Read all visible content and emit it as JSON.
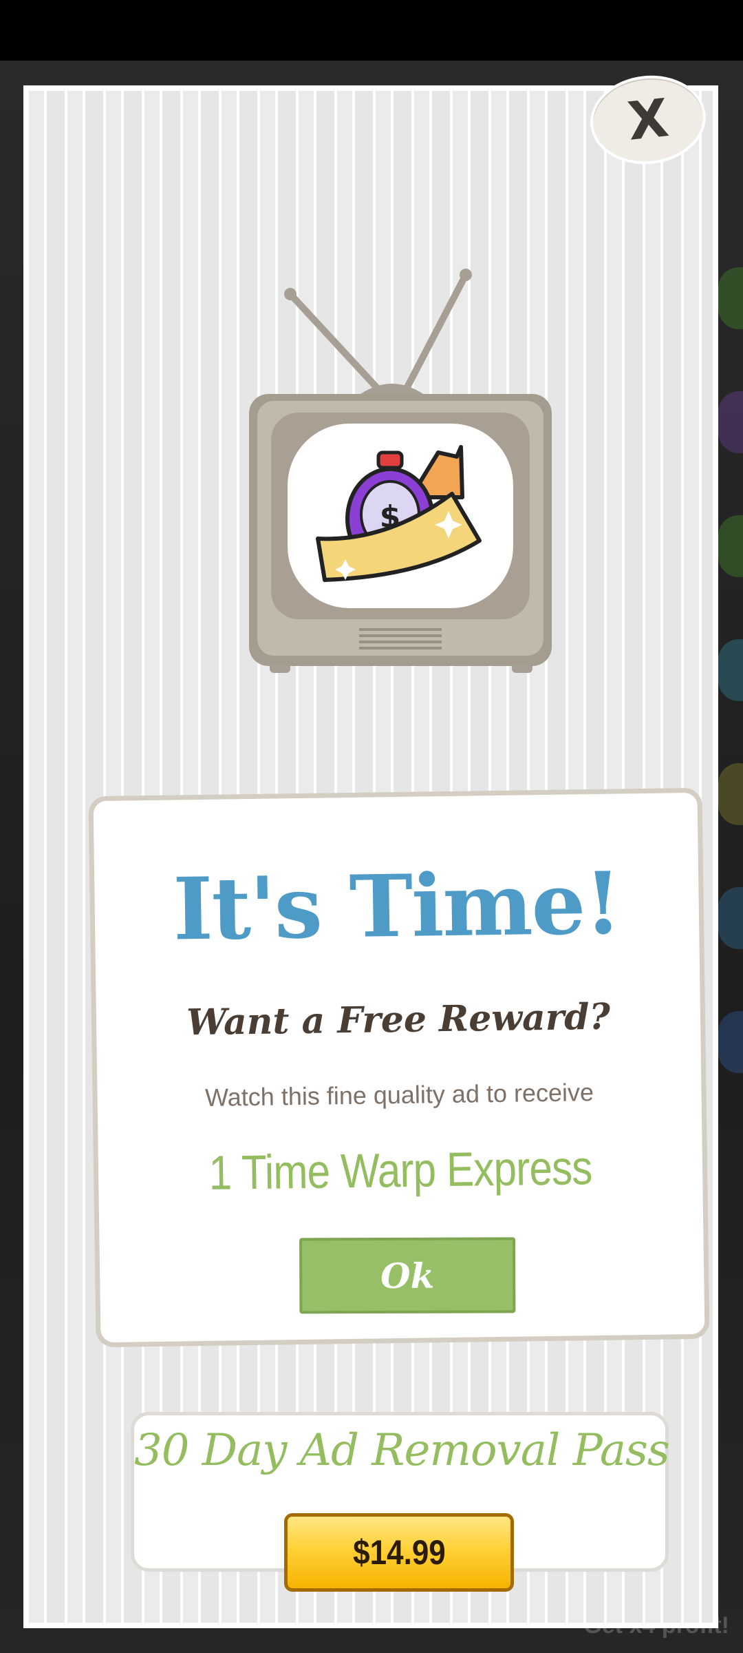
{
  "modal": {
    "close_label": "X",
    "title": "It's Time!",
    "subtitle": "Want a Free Reward?",
    "description": "Watch this fine quality ad to receive",
    "reward": "1 Time Warp Express",
    "ok_label": "Ok"
  },
  "pass": {
    "title": "30 Day Ad Removal Pass",
    "price": "$14.99"
  },
  "background": {
    "bottom_text": "Get x4 profit!"
  },
  "icons": {
    "tv": "tv-icon",
    "reward": "money-stopwatch-icon",
    "close": "close-icon"
  },
  "colors": {
    "title_blue": "#4e9bc8",
    "accent_green": "#96bf66",
    "price_gold": "#ffd138",
    "tv_gray": "#bfb6aa"
  }
}
